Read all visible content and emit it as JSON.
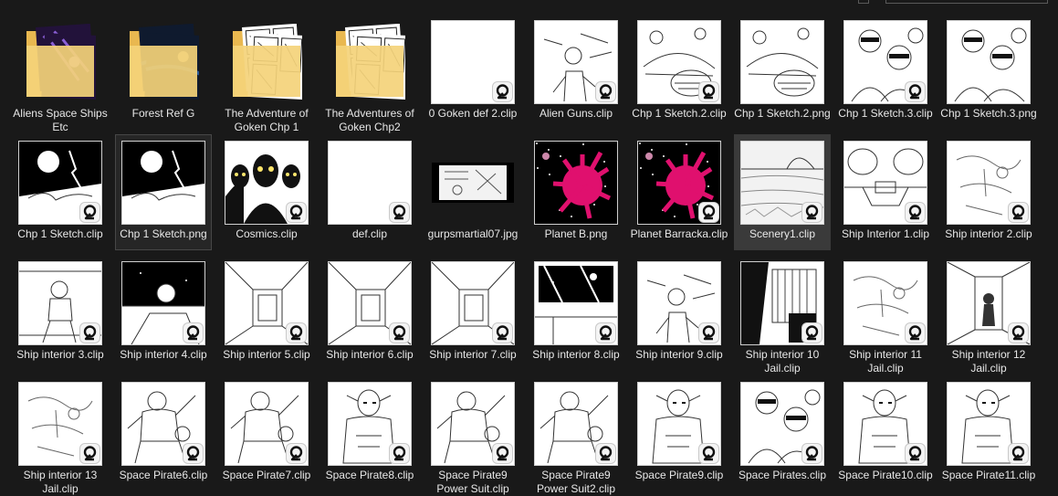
{
  "colors": {
    "background": "#191919",
    "label": "#e8e8e8",
    "folder": "#f4d27a",
    "magenta": "#e0106e"
  },
  "files": [
    {
      "label": "Aliens Space Ships Etc",
      "kind": "folder",
      "art": "space"
    },
    {
      "label": "Forest Ref G",
      "kind": "folder",
      "art": "forest"
    },
    {
      "label": "The Adventure of Goken Chp 1",
      "kind": "folder",
      "art": "comic"
    },
    {
      "label": "The Adventures of Goken Chp2",
      "kind": "folder",
      "art": "comic"
    },
    {
      "label": "0 Goken def 2.clip",
      "kind": "clip",
      "art": "blank"
    },
    {
      "label": "Alien Guns.clip",
      "kind": "clip",
      "art": "figure"
    },
    {
      "label": "Chp 1 Sketch.2.clip",
      "kind": "clip",
      "art": "ship"
    },
    {
      "label": "Chp 1 Sketch.2.png",
      "kind": "png",
      "art": "ship"
    },
    {
      "label": "Chp 1 Sketch.3.clip",
      "kind": "clip",
      "art": "group"
    },
    {
      "label": "Chp 1 Sketch.3.png",
      "kind": "png",
      "art": "group"
    },
    {
      "label": "Chp 1 Sketch.clip",
      "kind": "clip",
      "art": "nightcity"
    },
    {
      "label": "Chp 1 Sketch.png",
      "kind": "png",
      "art": "nightcity",
      "selected": true
    },
    {
      "label": "Cosmics.clip",
      "kind": "clip",
      "art": "cosmics"
    },
    {
      "label": "def.clip",
      "kind": "clip",
      "art": "blank"
    },
    {
      "label": "gurpsmartial07.jpg",
      "kind": "jpg",
      "art": "strip"
    },
    {
      "label": "Planet B.png",
      "kind": "png",
      "art": "planet"
    },
    {
      "label": "Planet Barracka.clip",
      "kind": "clip",
      "art": "planet"
    },
    {
      "label": "Scenery1.clip",
      "kind": "clip",
      "art": "scenery",
      "hover": true
    },
    {
      "label": "Ship Interior 1.clip",
      "kind": "clip",
      "art": "interior"
    },
    {
      "label": "Ship interior 2.clip",
      "kind": "clip",
      "art": "sketch"
    },
    {
      "label": "Ship interior 3.clip",
      "kind": "clip",
      "art": "runner"
    },
    {
      "label": "Ship interior 4.clip",
      "kind": "clip",
      "art": "cockpit"
    },
    {
      "label": "Ship interior 5.clip",
      "kind": "clip",
      "art": "room"
    },
    {
      "label": "Ship interior 6.clip",
      "kind": "clip",
      "art": "room"
    },
    {
      "label": "Ship interior 7.clip",
      "kind": "clip",
      "art": "room"
    },
    {
      "label": "Ship interior 8.clip",
      "kind": "clip",
      "art": "window"
    },
    {
      "label": "Ship interior 9.clip",
      "kind": "clip",
      "art": "figure"
    },
    {
      "label": "Ship interior 10 Jail.clip",
      "kind": "clip",
      "art": "jail"
    },
    {
      "label": "Ship interior 11 Jail.clip",
      "kind": "clip",
      "art": "sketch"
    },
    {
      "label": "Ship interior 12 Jail.clip",
      "kind": "clip",
      "art": "corridor"
    },
    {
      "label": "Ship interior 13 Jail.clip",
      "kind": "clip",
      "art": "sketch"
    },
    {
      "label": "Space Pirate6.clip",
      "kind": "clip",
      "art": "pirate"
    },
    {
      "label": "Space Pirate7.clip",
      "kind": "clip",
      "art": "pirate"
    },
    {
      "label": "Space Pirate8.clip",
      "kind": "clip",
      "art": "alien"
    },
    {
      "label": "Space Pirate9 Power Suit.clip",
      "kind": "clip",
      "art": "pirate"
    },
    {
      "label": "Space Pirate9 Power Suit2.clip",
      "kind": "clip",
      "art": "pirate"
    },
    {
      "label": "Space Pirate9.clip",
      "kind": "clip",
      "art": "alien"
    },
    {
      "label": "Space Pirates.clip",
      "kind": "clip",
      "art": "group"
    },
    {
      "label": "Space Pirate10.clip",
      "kind": "clip",
      "art": "alien"
    },
    {
      "label": "Space Pirate11.clip",
      "kind": "clip",
      "art": "alien"
    }
  ]
}
